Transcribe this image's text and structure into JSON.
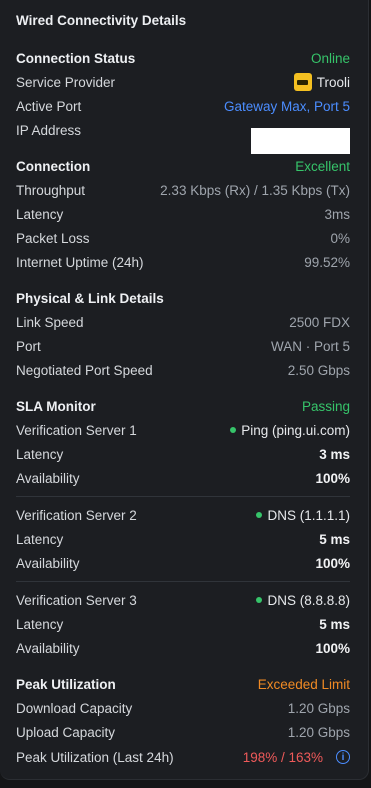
{
  "title": "Wired Connectivity Details",
  "connection_status": {
    "label": "Connection Status",
    "value": "Online",
    "provider_label": "Service Provider",
    "provider_value": "Trooli",
    "port_label": "Active Port",
    "port_value": "Gateway Max, Port 5",
    "ip_label": "IP Address"
  },
  "connection": {
    "label": "Connection",
    "value": "Excellent",
    "throughput_label": "Throughput",
    "throughput_value": "2.33 Kbps (Rx) / 1.35 Kbps (Tx)",
    "latency_label": "Latency",
    "latency_value": "3ms",
    "loss_label": "Packet Loss",
    "loss_value": "0%",
    "uptime_label": "Internet Uptime (24h)",
    "uptime_value": "99.52%"
  },
  "physical": {
    "label": "Physical & Link Details",
    "speed_label": "Link Speed",
    "speed_value": "2500 FDX",
    "port_label": "Port",
    "port_value": "WAN · Port 5",
    "neg_label": "Negotiated Port Speed",
    "neg_value": "2.50 Gbps"
  },
  "sla": {
    "label": "SLA Monitor",
    "value": "Passing",
    "servers": [
      {
        "label": "Verification Server 1",
        "value": "Ping (ping.ui.com)",
        "latency_label": "Latency",
        "latency_value": "3 ms",
        "avail_label": "Availability",
        "avail_value": "100%"
      },
      {
        "label": "Verification Server 2",
        "value": "DNS (1.1.1.1)",
        "latency_label": "Latency",
        "latency_value": "5 ms",
        "avail_label": "Availability",
        "avail_value": "100%"
      },
      {
        "label": "Verification Server 3",
        "value": "DNS (8.8.8.8)",
        "latency_label": "Latency",
        "latency_value": "5 ms",
        "avail_label": "Availability",
        "avail_value": "100%"
      }
    ]
  },
  "peak": {
    "label": "Peak Utilization",
    "value": "Exceeded Limit",
    "download_label": "Download Capacity",
    "download_value": "1.20 Gbps",
    "upload_label": "Upload Capacity",
    "upload_value": "1.20 Gbps",
    "util_label": "Peak Utilization (Last 24h)",
    "util_value": "198% / 163%"
  },
  "colors": {
    "online": "#36c46a",
    "link": "#4b8dff",
    "warning": "#f08a24",
    "danger": "#ef5a5a",
    "panel": "#1c1e22"
  },
  "icons": {
    "provider_logo": "trooli-logo-icon",
    "status_dot": "status-dot-icon",
    "info": "info-icon"
  }
}
